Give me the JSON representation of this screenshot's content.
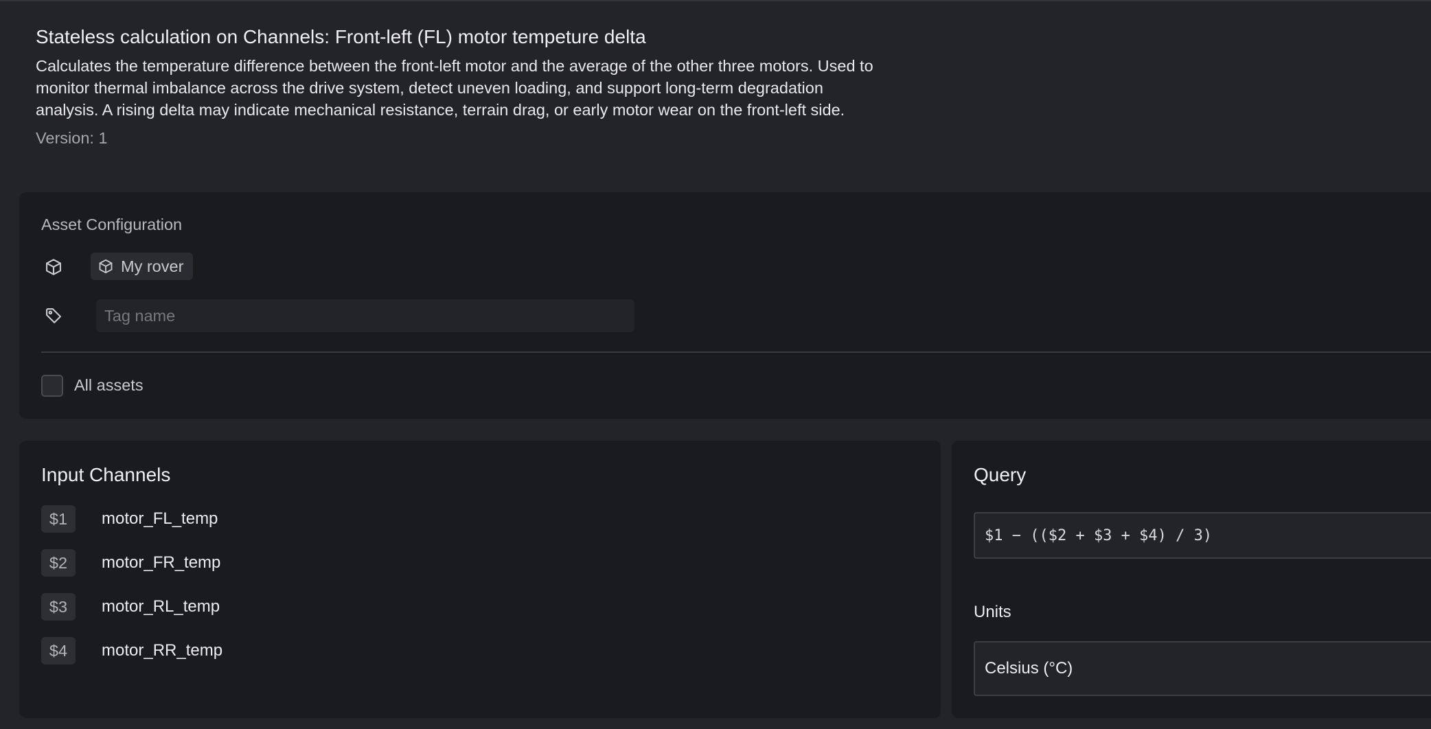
{
  "header": {
    "title": "Stateless calculation on Channels: Front-left (FL) motor tempeture delta",
    "description": "Calculates the temperature difference between the front-left motor and the average of the other three motors. Used to monitor thermal imbalance across the drive system, detect uneven loading, and support long-term degradation analysis. A rising delta may indicate mechanical resistance, terrain drag, or early motor wear on the front-left side.",
    "version": "Version: 1"
  },
  "asset_configuration": {
    "label": "Asset Configuration",
    "asset_icon": "cube-icon",
    "tag_icon": "tag-icon",
    "selected_asset": "My rover",
    "tag_input": {
      "placeholder": "Tag name",
      "value": ""
    },
    "all_assets": {
      "label": "All assets",
      "checked": false
    }
  },
  "input_channels": {
    "title": "Input Channels",
    "channels": [
      {
        "var": "$1",
        "name": "motor_FL_temp"
      },
      {
        "var": "$2",
        "name": "motor_FR_temp"
      },
      {
        "var": "$3",
        "name": "motor_RL_temp"
      },
      {
        "var": "$4",
        "name": "motor_RR_temp"
      }
    ]
  },
  "query": {
    "title": "Query",
    "expression": "$1 − (($2 + $3 + $4) / 3)",
    "units_label": "Units",
    "units_value": "Celsius (°C)"
  },
  "colors": {
    "background": "#232428",
    "card": "#1a1b1e",
    "chip": "#2b2c31",
    "border": "#3d3e44"
  }
}
